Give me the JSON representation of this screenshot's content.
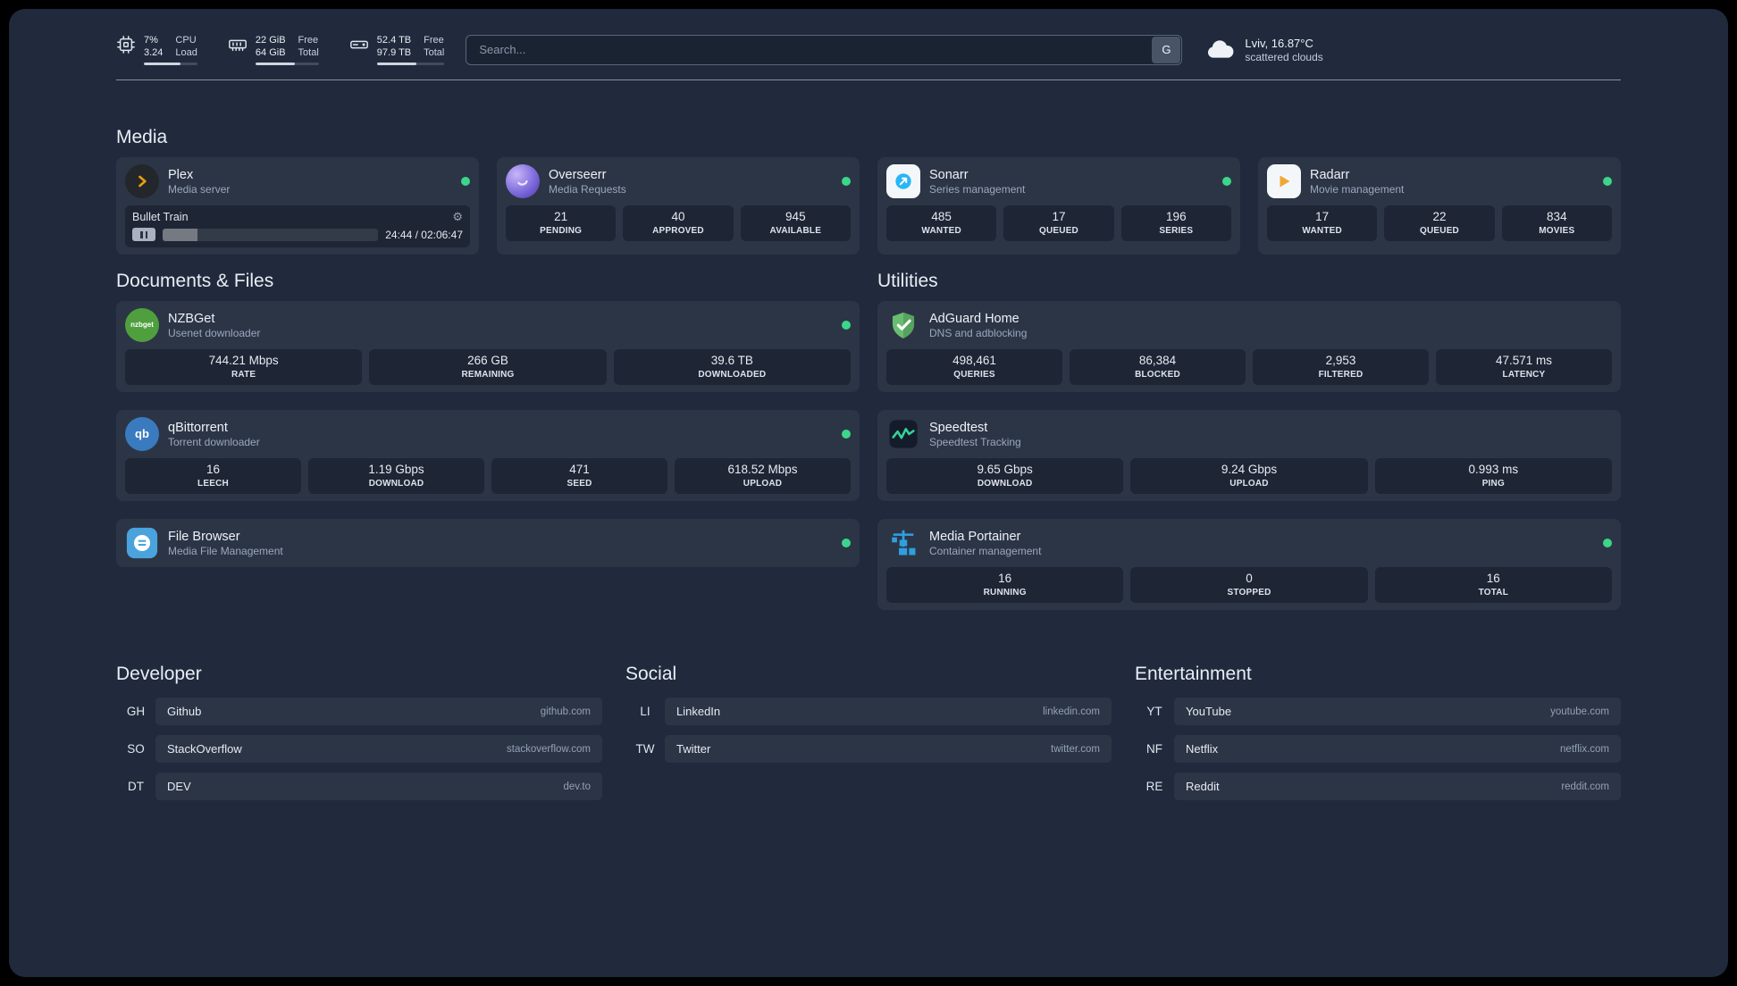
{
  "topbar": {
    "cpu": {
      "value_top": "7%",
      "value_bottom": "3.24",
      "label_top": "CPU",
      "label_bottom": "Load"
    },
    "ram": {
      "value_top": "22 GiB",
      "value_bottom": "64 GiB",
      "label_top": "Free",
      "label_bottom": "Total"
    },
    "disk": {
      "value_top": "52.4 TB",
      "value_bottom": "97.9 TB",
      "label_top": "Free",
      "label_bottom": "Total"
    },
    "search": {
      "placeholder": "Search...",
      "provider": "G"
    },
    "weather": {
      "location": "Lviv, 16.87°C",
      "condition": "scattered clouds"
    }
  },
  "sections": {
    "media": "Media",
    "documents": "Documents & Files",
    "utilities": "Utilities",
    "developer": "Developer",
    "social": "Social",
    "entertainment": "Entertainment"
  },
  "services": {
    "plex": {
      "title": "Plex",
      "subtitle": "Media server",
      "track": "Bullet Train",
      "time": "24:44 / 02:06:47"
    },
    "overseerr": {
      "title": "Overseerr",
      "subtitle": "Media Requests",
      "stats": [
        {
          "value": "21",
          "label": "PENDING"
        },
        {
          "value": "40",
          "label": "APPROVED"
        },
        {
          "value": "945",
          "label": "AVAILABLE"
        }
      ]
    },
    "sonarr": {
      "title": "Sonarr",
      "subtitle": "Series management",
      "stats": [
        {
          "value": "485",
          "label": "WANTED"
        },
        {
          "value": "17",
          "label": "QUEUED"
        },
        {
          "value": "196",
          "label": "SERIES"
        }
      ]
    },
    "radarr": {
      "title": "Radarr",
      "subtitle": "Movie management",
      "stats": [
        {
          "value": "17",
          "label": "WANTED"
        },
        {
          "value": "22",
          "label": "QUEUED"
        },
        {
          "value": "834",
          "label": "MOVIES"
        }
      ]
    },
    "nzbget": {
      "title": "NZBGet",
      "subtitle": "Usenet downloader",
      "icon_text": "nzbget",
      "stats": [
        {
          "value": "744.21 Mbps",
          "label": "RATE"
        },
        {
          "value": "266 GB",
          "label": "REMAINING"
        },
        {
          "value": "39.6 TB",
          "label": "DOWNLOADED"
        }
      ]
    },
    "qbittorrent": {
      "title": "qBittorrent",
      "subtitle": "Torrent downloader",
      "icon_text": "qb",
      "stats": [
        {
          "value": "16",
          "label": "LEECH"
        },
        {
          "value": "1.19 Gbps",
          "label": "DOWNLOAD"
        },
        {
          "value": "471",
          "label": "SEED"
        },
        {
          "value": "618.52 Mbps",
          "label": "UPLOAD"
        }
      ]
    },
    "filebrowser": {
      "title": "File Browser",
      "subtitle": "Media File Management"
    },
    "adguard": {
      "title": "AdGuard Home",
      "subtitle": "DNS and adblocking",
      "stats": [
        {
          "value": "498,461",
          "label": "QUERIES"
        },
        {
          "value": "86,384",
          "label": "BLOCKED"
        },
        {
          "value": "2,953",
          "label": "FILTERED"
        },
        {
          "value": "47.571 ms",
          "label": "LATENCY"
        }
      ]
    },
    "speedtest": {
      "title": "Speedtest",
      "subtitle": "Speedtest Tracking",
      "stats": [
        {
          "value": "9.65 Gbps",
          "label": "DOWNLOAD"
        },
        {
          "value": "9.24 Gbps",
          "label": "UPLOAD"
        },
        {
          "value": "0.993 ms",
          "label": "PING"
        }
      ]
    },
    "portainer": {
      "title": "Media Portainer",
      "subtitle": "Container management",
      "stats": [
        {
          "value": "16",
          "label": "RUNNING"
        },
        {
          "value": "0",
          "label": "STOPPED"
        },
        {
          "value": "16",
          "label": "TOTAL"
        }
      ]
    }
  },
  "bookmarks": {
    "developer": {
      "items": [
        {
          "abbr": "GH",
          "name": "Github",
          "url": "github.com"
        },
        {
          "abbr": "SO",
          "name": "StackOverflow",
          "url": "stackoverflow.com"
        },
        {
          "abbr": "DT",
          "name": "DEV",
          "url": "dev.to"
        }
      ]
    },
    "social": {
      "items": [
        {
          "abbr": "LI",
          "name": "LinkedIn",
          "url": "linkedin.com"
        },
        {
          "abbr": "TW",
          "name": "Twitter",
          "url": "twitter.com"
        }
      ]
    },
    "entertainment": {
      "items": [
        {
          "abbr": "YT",
          "name": "YouTube",
          "url": "youtube.com"
        },
        {
          "abbr": "NF",
          "name": "Netflix",
          "url": "netflix.com"
        },
        {
          "abbr": "RE",
          "name": "Reddit",
          "url": "reddit.com"
        }
      ]
    }
  },
  "colors": {
    "background": "#202a3c",
    "status_green": "#3cd68a",
    "plex_amber": "#e5a00d",
    "adguard_green": "#68bd71",
    "portainer_blue": "#2f9fe0",
    "speedtest_green": "#34d399"
  }
}
